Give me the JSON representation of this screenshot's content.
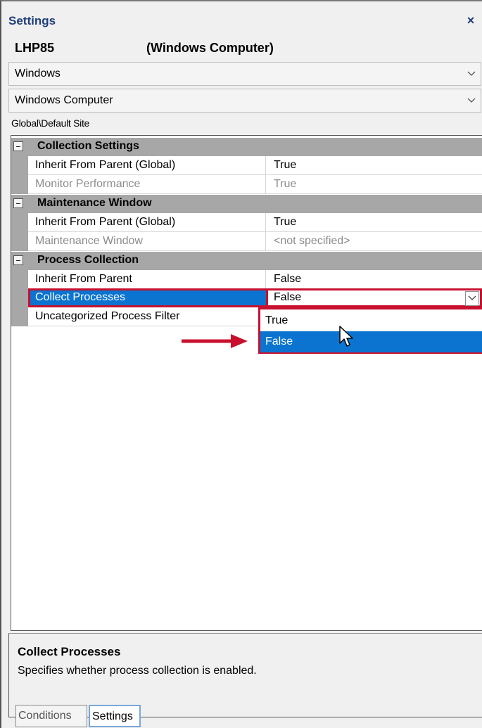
{
  "title": "Settings",
  "close_glyph": "×",
  "object": {
    "name": "LHP85",
    "type": "(Windows Computer)"
  },
  "combos": [
    {
      "value": "Windows"
    },
    {
      "value": "Windows Computer"
    }
  ],
  "site_path": "Global\\Default Site",
  "categories": [
    {
      "label": "Collection Settings",
      "rows": [
        {
          "name": "Inherit From Parent (Global)",
          "value": "True",
          "disabled": false
        },
        {
          "name": "Monitor Performance",
          "value": "True",
          "disabled": true
        }
      ]
    },
    {
      "label": "Maintenance Window",
      "rows": [
        {
          "name": "Inherit From Parent (Global)",
          "value": "True",
          "disabled": false
        },
        {
          "name": "Maintenance Window",
          "value": "<not specified>",
          "disabled": true
        }
      ]
    },
    {
      "label": "Process Collection",
      "rows": [
        {
          "name": "Inherit From Parent",
          "value": "False",
          "disabled": false
        },
        {
          "name": "Collect Processes",
          "value": "False",
          "selected": true
        },
        {
          "name": "Uncategorized Process Filter",
          "value": "",
          "disabled": false
        }
      ]
    }
  ],
  "dropdown_options": [
    "True",
    "False"
  ],
  "dropdown_highlighted": "False",
  "description": {
    "title": "Collect Processes",
    "text": "Specifies whether process collection is enabled."
  },
  "tabs": [
    {
      "label": "Conditions",
      "active": false
    },
    {
      "label": "Settings",
      "active": true
    }
  ],
  "colors": {
    "highlight": "#0b74d1",
    "annotation_red": "#c8102e",
    "category_gray": "#a7a7a7",
    "title_blue": "#1f3f7a"
  },
  "icons": [
    "close-icon",
    "chevron-down-icon",
    "collapse-icon",
    "dropdown-arrow-icon",
    "annotation-arrow-icon",
    "mouse-cursor-icon"
  ]
}
